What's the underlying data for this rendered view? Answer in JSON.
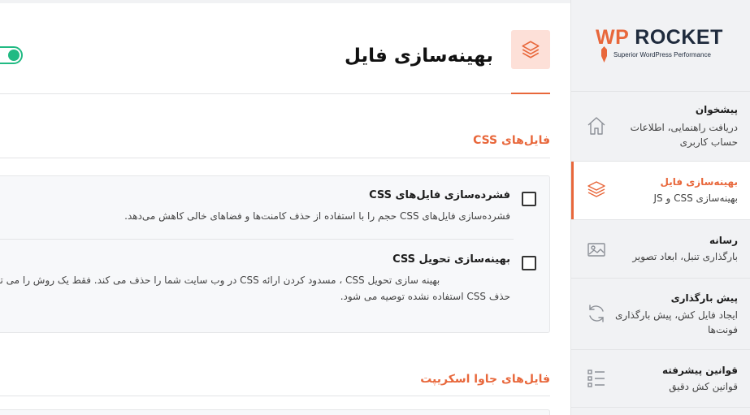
{
  "page": {
    "title": "بهینه‌سازی فایل",
    "toggle_on": true
  },
  "sections": {
    "css": {
      "title": "فایل‌های CSS"
    },
    "js": {
      "title": "فایل‌های جاوا اسکریپت"
    }
  },
  "options": [
    {
      "title": "فشرده‌سازی فایل‌های CSS",
      "description": "فشرده‌سازی فایل‌های CSS حجم را با استفاده از حذف کامنت‌ها و فضاهای خالی کاهش می‌دهد.",
      "checked": false
    },
    {
      "title": "بهینه‌سازی تحویل CSS",
      "description_line1": "بهینه سازی تحویل CSS ، مسدود کردن ارائه CSS در وب سایت شما را حذف می کند. فقط یک روش را می توان انتخاب کرد.",
      "description_line2": "حذف CSS استفاده نشده توصیه می شود.",
      "checked": false
    }
  ],
  "sidebar": {
    "logo": {
      "wp": "WP",
      "rocket": "ROCKET",
      "tagline": "Superior WordPress Performance"
    },
    "items": [
      {
        "title": "پیشخوان",
        "subtitle": "دریافت راهنمایی، اطلاعات حساب کاربری",
        "icon": "home-icon",
        "active": false
      },
      {
        "title": "بهینه‌سازی فایل",
        "subtitle": "بهینه‌سازی CSS و JS",
        "icon": "layers-icon",
        "active": true
      },
      {
        "title": "رسانه",
        "subtitle": "بارگذاری تنبل، ابعاد تصویر",
        "icon": "image-icon",
        "active": false
      },
      {
        "title": "پیش بارگذاری",
        "subtitle": "ایجاد فایل کش، پیش بارگذاری فونت‌ها",
        "icon": "refresh-icon",
        "active": false
      },
      {
        "title": "قوانین پیشرفته",
        "subtitle": "قوانین کش دقیق",
        "icon": "list-icon",
        "active": false
      }
    ]
  },
  "colors": {
    "accent": "#e8673b",
    "toggle": "#21ba83",
    "navy": "#1f2b3d"
  }
}
